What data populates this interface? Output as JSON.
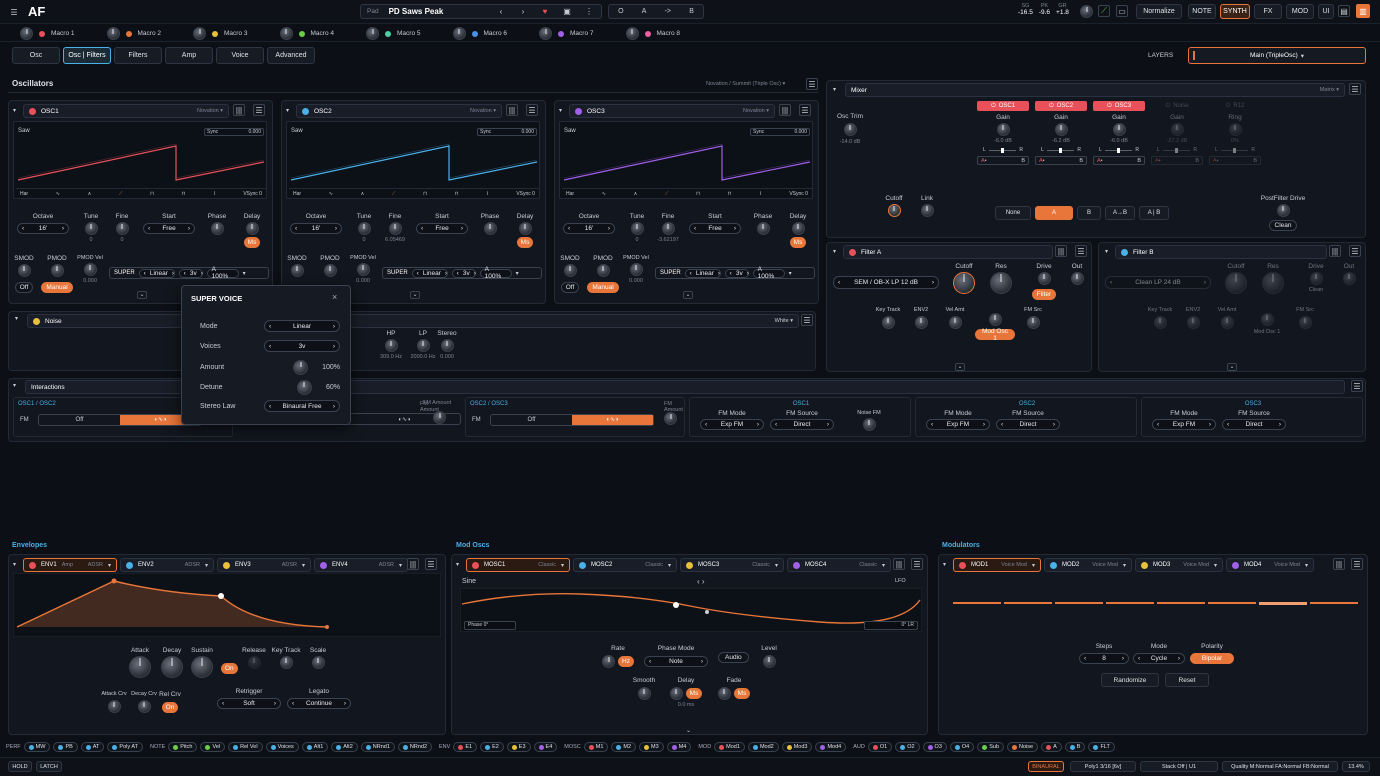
{
  "app": {
    "logo": "AF"
  },
  "topbar": {
    "preset_category": "Pad",
    "preset_name": "PD Saws Peak",
    "ab": [
      "O",
      "A",
      "->",
      "B"
    ],
    "meter": [
      {
        "top": "SG",
        "val": "-16.5"
      },
      {
        "top": "PK",
        "val": "-9.6"
      },
      {
        "top": "GR",
        "val": "+1.8"
      }
    ],
    "normalize": "Normalize",
    "buttons": [
      "NOTE",
      "SYNTH",
      "FX",
      "MOD",
      "UI"
    ]
  },
  "macros": [
    {
      "name": "Macro 1",
      "color": "#e8505a"
    },
    {
      "name": "Macro 2",
      "color": "#e8763a"
    },
    {
      "name": "Macro 3",
      "color": "#e8c03a"
    },
    {
      "name": "Macro 4",
      "color": "#6ad04a"
    },
    {
      "name": "Macro 5",
      "color": "#4ad0a0"
    },
    {
      "name": "Macro 6",
      "color": "#4a90e8"
    },
    {
      "name": "Macro 7",
      "color": "#a060e8"
    },
    {
      "name": "Macro 8",
      "color": "#e860a0"
    }
  ],
  "tabs": [
    "Osc",
    "Osc | Filters",
    "Filters",
    "Amp",
    "Voice",
    "Advanced"
  ],
  "layers": {
    "label": "LAYERS",
    "value": "Main (TripleOsc)"
  },
  "oscillators": {
    "title": "Oscillators",
    "mode": "Novation / Summit (Triple Osc)",
    "units": [
      {
        "name": "OSC1",
        "model": "Novation",
        "wave": "Saw",
        "sync_label": "Sync",
        "sync": "0.000",
        "bar_left": "Har",
        "bar_right": "VSync",
        "bar_right_val": "0",
        "octave": "16'",
        "tune": "0",
        "fine": "0",
        "fine_label": "Fine",
        "start": "Free",
        "ms": "Ms",
        "smod": "Off",
        "pmod": "Manual",
        "pmodvel": "0.000",
        "super_mode": "Linear",
        "super_voices": "3v",
        "super_amt": "A 100%",
        "color": "#e8505a"
      },
      {
        "name": "OSC2",
        "model": "Novation",
        "wave": "Saw",
        "sync_label": "Sync",
        "sync": "0.000",
        "bar_left": "Har",
        "bar_right": "VSync",
        "bar_right_val": "0",
        "octave": "16'",
        "tune": "0",
        "fine": "6.05469",
        "fine_label": "Fine",
        "start": "Free",
        "ms": "Ms",
        "smod": "",
        "pmod": "",
        "pmodvel": "0.000",
        "super_mode": "Linear",
        "super_voices": "3v",
        "super_amt": "A 100%",
        "color": "#4ab0e8"
      },
      {
        "name": "OSC3",
        "model": "Novation",
        "wave": "Saw",
        "sync_label": "Sync",
        "sync": "0.000",
        "bar_left": "Har",
        "bar_right": "VSync",
        "bar_right_val": "0",
        "octave": "16'",
        "tune": "0",
        "fine": "-3.62197",
        "fine_label": "Fine",
        "start": "Free",
        "ms": "Ms",
        "smod": "Off",
        "pmod": "Manual",
        "pmodvel": "0.000",
        "super_mode": "Linear",
        "super_voices": "3v",
        "super_amt": "A 100%",
        "color": "#a060e8"
      }
    ],
    "labels": {
      "octave": "Octave",
      "tune": "Tune",
      "start": "Start",
      "phase": "Phase",
      "delay": "Delay",
      "smod": "SMOD",
      "pmod": "PMOD",
      "pmodvel": "PMOD Vel",
      "super": "SUPER"
    }
  },
  "noise": {
    "name": "Noise",
    "type": "White",
    "hp_label": "HP",
    "hp": "309.0 Hz",
    "lp_label": "LP",
    "lp": "2000.0 Hz",
    "stereo_label": "Stereo",
    "stereo": "0.000"
  },
  "super_voice": {
    "title": "SUPER VOICE",
    "rows": [
      {
        "label": "Mode",
        "value": "Linear",
        "kind": "sel"
      },
      {
        "label": "Voices",
        "value": "3v",
        "kind": "sel"
      },
      {
        "label": "Amount",
        "value": "100%",
        "kind": "knob"
      },
      {
        "label": "Detune",
        "value": "60%",
        "kind": "knob"
      },
      {
        "label": "Stereo Law",
        "value": "Binaural Free",
        "kind": "sel"
      }
    ]
  },
  "mixer": {
    "title": "Mixer",
    "mode": "Matrix",
    "osc_trim_label": "Osc Trim",
    "osc_trim": "-14.0 dB",
    "channels": [
      {
        "name": "OSC1",
        "gain": "-6.0 dB",
        "active": true
      },
      {
        "name": "OSC2",
        "gain": "-6.2 dB",
        "active": true
      },
      {
        "name": "OSC3",
        "gain": "-6.0 dB",
        "active": true
      },
      {
        "name": "Noise",
        "gain": "-27.2 dB",
        "active": false
      },
      {
        "name": "R12",
        "gain": "0%",
        "active": false
      }
    ],
    "gain_label": "Gain",
    "ring_label": "Ring",
    "l": "L",
    "r": "R",
    "a": "A",
    "b": "B",
    "cutoff_label": "Cutoff",
    "link_label": "Link",
    "routing": [
      "None",
      "A",
      "B",
      "A→B",
      "A | B"
    ],
    "postfilter_label": "PostFilter Drive",
    "clean": "Clean"
  },
  "filter_a": {
    "name": "Filter A",
    "type": "SEM / OB-X  LP 12 dB",
    "cutoff_label": "Cutoff",
    "cutoff": "45k",
    "res_label": "Res",
    "res": "38%",
    "drive_label": "Drive",
    "drive": "Filter",
    "out_label": "Out",
    "keytrack": "Key Track",
    "env2": "ENV2",
    "velamt": "Vel Amt",
    "fmsrc": "FM Src",
    "fm_btn": "Mod Osc 1"
  },
  "filter_b": {
    "name": "Filter B",
    "type": "Clean  LP 24 dB",
    "cutoff_label": "Cutoff",
    "cutoff": "100k",
    "res_label": "Res",
    "res": "0%",
    "drive_label": "Drive",
    "drive": "Clean",
    "out_label": "Out",
    "keytrack": "Key Track",
    "env2": "ENV2",
    "velamt": "Vel Amt",
    "fmsrc": "FM Src",
    "fm_btn": "Mod Osc 1"
  },
  "interactions": {
    "title": "Interactions",
    "pairs": [
      {
        "name": "OSC1 / OSC2",
        "fm": "FM",
        "off": "Off",
        "amt": "FM Amount"
      },
      {
        "name": "OSC2 / OSC3",
        "fm": "FM",
        "off": "Off",
        "amt": "FM Amount"
      }
    ],
    "fm_blocks": [
      {
        "name": "OSC1",
        "mode_label": "FM Mode",
        "mode": "Exp FM",
        "src_label": "FM Source",
        "src": "Direct",
        "noise_label": "Noise FM"
      },
      {
        "name": "OSC2",
        "mode_label": "FM Mode",
        "mode": "Exp FM",
        "src_label": "FM Source",
        "src": "Direct"
      },
      {
        "name": "OSC3",
        "mode_label": "FM Mode",
        "mode": "Exp FM",
        "src_label": "FM Source",
        "src": "Direct"
      }
    ]
  },
  "envelopes": {
    "title": "Envelopes",
    "tabs": [
      {
        "name": "ENV1",
        "sub": "Amp",
        "type": "ADSR",
        "color": "#e8505a"
      },
      {
        "name": "ENV2",
        "sub": "",
        "type": "ADSR",
        "color": "#4ab0e8"
      },
      {
        "name": "ENV3",
        "sub": "",
        "type": "ADSR",
        "color": "#e8c03a"
      },
      {
        "name": "ENV4",
        "sub": "",
        "type": "ADSR",
        "color": "#a060e8"
      }
    ],
    "knobs": [
      {
        "label": "Attack",
        "val": "14%"
      },
      {
        "label": "Decay",
        "val": "60%"
      },
      {
        "label": "Sustain",
        "val": "40%"
      },
      {
        "label": "Release",
        "val": ""
      },
      {
        "label": "Key Track",
        "val": ""
      },
      {
        "label": "Scale",
        "val": ""
      }
    ],
    "attack_crv": "Attack Crv",
    "decay_crv": "Decay Crv",
    "rel_crv": "Rel Crv",
    "retrigger_label": "Retrigger",
    "retrigger": "Soft",
    "legato_label": "Legato",
    "legato": "Continue",
    "on": "On"
  },
  "modoscs": {
    "title": "Mod Oscs",
    "tabs": [
      {
        "name": "MOSC1",
        "type": "Classic",
        "color": "#e8505a"
      },
      {
        "name": "MOSC2",
        "type": "Classic",
        "color": "#4ab0e8"
      },
      {
        "name": "MOSC3",
        "type": "Classic",
        "color": "#e8c03a"
      },
      {
        "name": "MOSC4",
        "type": "Classic",
        "color": "#a060e8"
      }
    ],
    "wave": "Sine",
    "lfo": "LFO",
    "phase_label": "Phase",
    "phase": "0°",
    "phase2": "0°",
    "rate_label": "Rate",
    "rate_unit": "Hz",
    "phase_mode_label": "Phase Mode",
    "phase_mode": "Note",
    "audio": "Audio",
    "level_label": "Level",
    "smooth_label": "Smooth",
    "delay_label": "Delay",
    "delay_unit": "Ms",
    "delay_val": "0.0 ms",
    "fade_label": "Fade",
    "fade_unit": "Ms"
  },
  "modulators": {
    "title": "Modulators",
    "tabs": [
      {
        "name": "MOD1",
        "type": "Voice Mod",
        "color": "#e8505a"
      },
      {
        "name": "MOD2",
        "type": "Voice Mod",
        "color": "#4ab0e8"
      },
      {
        "name": "MOD3",
        "type": "Voice Mod",
        "color": "#e8c03a"
      },
      {
        "name": "MOD4",
        "type": "Voice Mod",
        "color": "#a060e8"
      }
    ],
    "steps_label": "Steps",
    "steps": "8",
    "mode_label": "Mode",
    "mode": "Cycle",
    "polarity_label": "Polarity",
    "polarity": "Bipolar",
    "randomize": "Randomize",
    "reset": "Reset"
  },
  "modbar": {
    "groups": [
      {
        "label": "PERF",
        "items": [
          "MW",
          "PB",
          "AT",
          "Poly AT"
        ]
      },
      {
        "label": "NOTE",
        "items": [
          "Pitch",
          "Vel",
          "Rel Vel",
          "Voices",
          "Alt1",
          "Alt2",
          "NRnd1",
          "NRnd2"
        ]
      },
      {
        "label": "ENV",
        "items": [
          "E1",
          "E2",
          "E3",
          "E4"
        ]
      },
      {
        "label": "MOSC",
        "items": [
          "M1",
          "M2",
          "M3",
          "M4"
        ]
      },
      {
        "label": "MOD",
        "items": [
          "Mod1",
          "Mod2",
          "Mod3",
          "Mod4"
        ]
      },
      {
        "label": "AUD",
        "items": [
          "O1",
          "O2",
          "O3",
          "O4",
          "Sub",
          "Noise",
          "A",
          "B",
          "FLT"
        ]
      }
    ]
  },
  "status": {
    "hold": "HOLD",
    "latch": "LATCH",
    "binaural": "BINAURAL",
    "poly": "Poly1 3/16 [6v]",
    "stack": "Stack Off | U1",
    "quality": "Quality M:Normal FA:Normal FB:Normal",
    "cpu": "13.4%"
  }
}
